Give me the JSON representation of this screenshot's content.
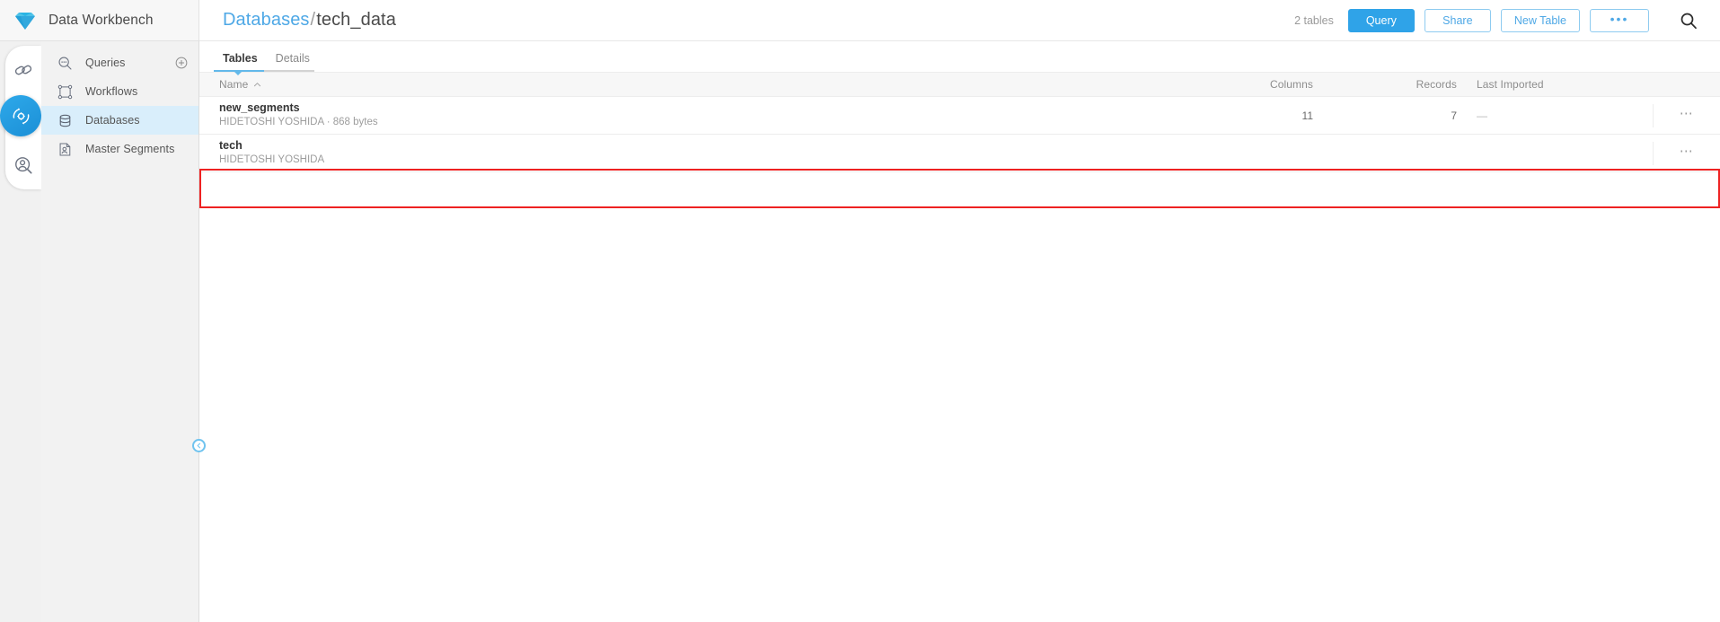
{
  "brand": {
    "title": "Data Workbench",
    "logo_icon": "diamond-gem-icon"
  },
  "header": {
    "breadcrumb": {
      "parent": "Databases",
      "separator": "/",
      "current": "tech_data"
    },
    "tables_count": "2 tables",
    "buttons": {
      "query": "Query",
      "share": "Share",
      "new_table": "New Table",
      "more": "•••"
    },
    "search_icon": "search-icon",
    "accent_color": "#2fa3e8",
    "link_color": "#4ea8e6"
  },
  "rail": {
    "items": [
      {
        "icon": "chain-link-icon",
        "active": false
      },
      {
        "icon": "gear-refresh-icon",
        "active": true
      },
      {
        "icon": "person-search-icon",
        "active": false
      }
    ],
    "active_color": "#1b8fd6"
  },
  "sidebar": {
    "items": [
      {
        "label": "Queries",
        "icon": "search-dots-icon",
        "selected": false,
        "add_icon": "plus-circle-icon"
      },
      {
        "label": "Workflows",
        "icon": "workflow-nodes-icon",
        "selected": false
      },
      {
        "label": "Databases",
        "icon": "database-cylinder-icon",
        "selected": true
      },
      {
        "label": "Master Segments",
        "icon": "person-document-icon",
        "selected": false
      }
    ],
    "selected_bg": "#d9eefb",
    "collapse_icon": "chevron-left-icon"
  },
  "main": {
    "tabs": [
      {
        "label": "Tables",
        "active": true
      },
      {
        "label": "Details",
        "active": false
      }
    ],
    "table": {
      "columns": [
        {
          "key": "name",
          "label": "Name",
          "sort": "asc",
          "sort_icon": "chevron-up-icon"
        },
        {
          "key": "columns",
          "label": "Columns"
        },
        {
          "key": "records",
          "label": "Records"
        },
        {
          "key": "last_imported",
          "label": "Last Imported"
        }
      ],
      "rows": [
        {
          "name": "new_segments",
          "owner": "HIDETOSHI YOSHIDA",
          "meta_separator": "·",
          "size": "868 bytes",
          "subtitle": "HIDETOSHI YOSHIDA · 868 bytes",
          "columns": "11",
          "records": "7",
          "last_imported": "—",
          "actions_icon": "ellipsis-menu-icon",
          "highlighted": false
        },
        {
          "name": "tech",
          "owner": "HIDETOSHI YOSHIDA",
          "subtitle": "HIDETOSHI YOSHIDA",
          "columns": "",
          "records": "",
          "last_imported": "",
          "actions_icon": "ellipsis-menu-icon",
          "highlighted": true
        }
      ]
    },
    "highlight_color": "#ee2222"
  }
}
